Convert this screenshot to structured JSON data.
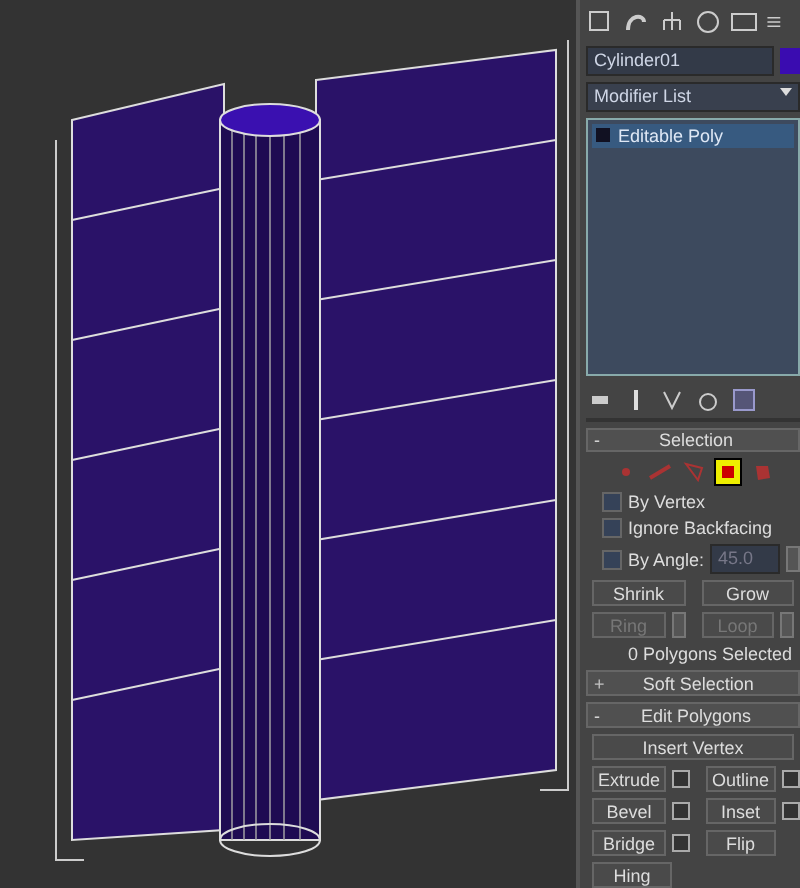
{
  "object_name": {
    "value": "Cylinder01",
    "color": "#3a0cb0"
  },
  "modifier_list": {
    "label": "Modifier List"
  },
  "stack": [
    {
      "label": "Editable Poly",
      "selected": true
    }
  ],
  "selection": {
    "title": "Selection",
    "toggle": "-",
    "expanded": true,
    "subobjects": [
      {
        "kind": "vertex",
        "selected": false
      },
      {
        "kind": "edge",
        "selected": false
      },
      {
        "kind": "border",
        "selected": false
      },
      {
        "kind": "polygon",
        "selected": true
      },
      {
        "kind": "element",
        "selected": false
      }
    ],
    "options": [
      {
        "label": "By Vertex",
        "checked": false
      },
      {
        "label": "Ignore Backfacing",
        "checked": false
      },
      {
        "label": "By Angle:",
        "checked": false
      }
    ],
    "angle": {
      "value": "45.0",
      "disabled": true
    },
    "buttons": [
      {
        "label": "Shrink",
        "disabled": false,
        "spinner": false
      },
      {
        "label": "Grow",
        "disabled": false,
        "spinner": false
      },
      {
        "label": "Ring",
        "disabled": true,
        "spinner": true
      },
      {
        "label": "Loop",
        "disabled": true,
        "spinner": true
      }
    ],
    "status": "0 Polygons Selected"
  },
  "soft_selection": {
    "title": "Soft Selection",
    "toggle": "+",
    "expanded": false
  },
  "edit_polygons": {
    "title": "Edit Polygons",
    "toggle": "-",
    "expanded": true,
    "wide_button": "Insert Vertex",
    "buttons": [
      {
        "label": "Extrude",
        "settings": true
      },
      {
        "label": "Outline",
        "settings": true
      },
      {
        "label": "Bevel",
        "settings": true
      },
      {
        "label": "Inset",
        "settings": true
      },
      {
        "label": "Bridge",
        "settings": true
      },
      {
        "label": "Flip",
        "settings": false
      }
    ],
    "last_button": "Hing"
  }
}
